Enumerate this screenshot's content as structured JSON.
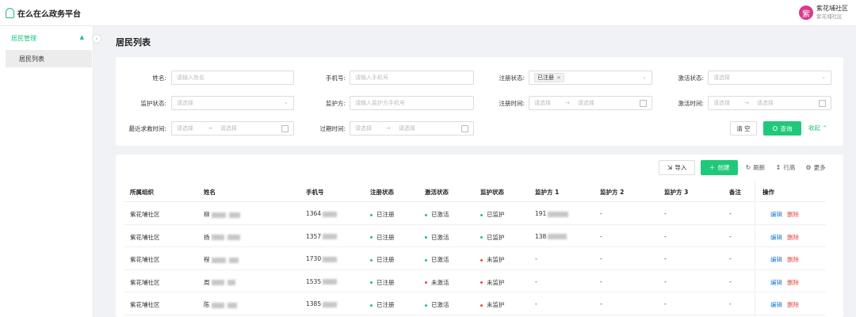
{
  "app": {
    "title": "在么在么政务平台"
  },
  "user": {
    "avatar_char": "紫",
    "name": "紫花埔社区",
    "org": "紫花埔社区"
  },
  "sidebar": {
    "group_label": "居民管理",
    "items": [
      {
        "label": "居民列表"
      }
    ]
  },
  "page": {
    "title": "居民列表"
  },
  "filters": {
    "name": {
      "label": "姓名:",
      "placeholder": "请输入姓名"
    },
    "phone": {
      "label": "手机号:",
      "placeholder": "请输入手机号"
    },
    "reg_status": {
      "label": "注册状态:",
      "selected_tag": "已注册"
    },
    "act_status": {
      "label": "激活状态:",
      "placeholder": "请选择"
    },
    "monitor_status": {
      "label": "监护状态:",
      "placeholder": "请选择"
    },
    "monitor_party": {
      "label": "监护方:",
      "placeholder": "请输入监护方手机号"
    },
    "reg_time": {
      "label": "注册时间:",
      "start": "请选择",
      "end": "请选择"
    },
    "act_time": {
      "label": "激活时间:",
      "start": "请选择",
      "end": "请选择"
    },
    "last_help_time": {
      "label": "最近求救时间:",
      "start": "请选择",
      "end": "请选择"
    },
    "expire_time": {
      "label": "过期时间:",
      "start": "请选择",
      "end": "请选择"
    },
    "clear_label": "清 空",
    "query_label": "查询",
    "collapse_label": "收起"
  },
  "toolbar": {
    "import_label": "导入",
    "create_label": "创建",
    "refresh_label": "刷新",
    "density_label": "行高",
    "more_label": "更多"
  },
  "table": {
    "headers": [
      "所属组织",
      "姓名",
      "手机号",
      "注册状态",
      "激活状态",
      "监护状态",
      "监护方 1",
      "监护方 2",
      "监护方 3",
      "备注",
      "操作"
    ],
    "actions": {
      "edit": "编辑",
      "delete": "删除"
    },
    "status_colors": {
      "ok": "#1fbf7a",
      "bad": "#e8483b"
    },
    "rows": [
      {
        "org": "紫花埔社区",
        "name": "柳",
        "phone": "1364",
        "reg": "已注册",
        "act": "已激活",
        "act_ok": true,
        "mon": "已监护",
        "mon_ok": true,
        "g1": "191",
        "g2": "-",
        "g3": "-",
        "note": "-"
      },
      {
        "org": "紫花埔社区",
        "name": "扬",
        "phone": "1357",
        "reg": "已注册",
        "act": "已激活",
        "act_ok": true,
        "mon": "已监护",
        "mon_ok": true,
        "g1": "138",
        "g2": "-",
        "g3": "-",
        "note": "-"
      },
      {
        "org": "紫花埔社区",
        "name": "程",
        "phone": "1730",
        "reg": "已注册",
        "act": "已激活",
        "act_ok": true,
        "mon": "未监护",
        "mon_ok": false,
        "g1": "-",
        "g2": "-",
        "g3": "-",
        "note": "-"
      },
      {
        "org": "紫花埔社区",
        "name": "周",
        "phone": "1535",
        "reg": "已注册",
        "act": "未激活",
        "act_ok": false,
        "mon": "未监护",
        "mon_ok": false,
        "g1": "-",
        "g2": "-",
        "g3": "-",
        "note": "-"
      },
      {
        "org": "紫花埔社区",
        "name": "陈",
        "phone": "1385",
        "reg": "已注册",
        "act": "已激活",
        "act_ok": true,
        "mon": "未监护",
        "mon_ok": false,
        "g1": "-",
        "g2": "-",
        "g3": "-",
        "note": "-"
      }
    ]
  }
}
